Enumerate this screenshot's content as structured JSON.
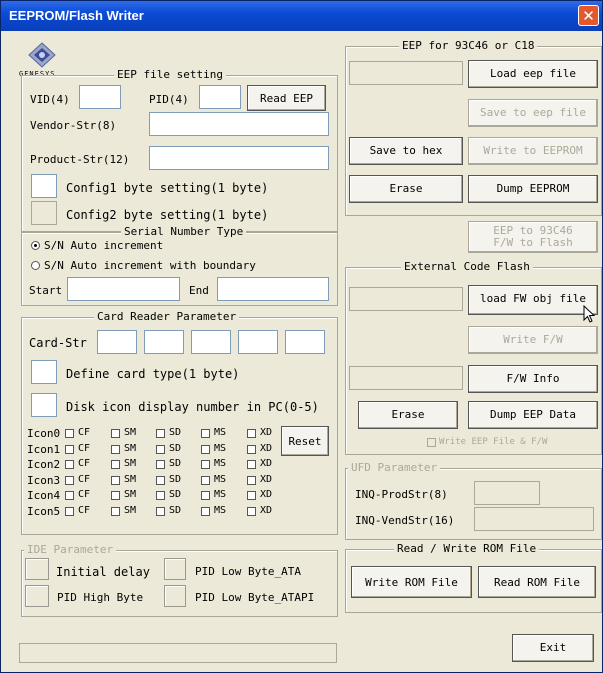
{
  "window": {
    "title": "EEPROM/Flash Writer",
    "close": "✕"
  },
  "logo": {
    "caption": "GENESYS"
  },
  "eep_file": {
    "legend": "EEP file setting",
    "vid_label": "VID(4)",
    "pid_label": "PID(4)",
    "read_eep": "Read EEP",
    "vendor_label": "Vendor-Str(8)",
    "product_label": "Product-Str(12)",
    "config1": "Config1 byte setting(1 byte)",
    "config2": "Config2 byte setting(1 byte)"
  },
  "serial": {
    "legend": "Serial Number Type",
    "opt1": "S/N Auto increment",
    "opt2": "S/N Auto increment with boundary",
    "start": "Start",
    "end": "End"
  },
  "card_reader": {
    "legend": "Card Reader Parameter",
    "card_str": "Card-Str",
    "define_type": "Define card type(1 byte)",
    "disk_icon": "Disk icon display number in PC(0-5)",
    "reset": "Reset",
    "columns": [
      "CF",
      "SM",
      "SD",
      "MS",
      "XD"
    ],
    "icons": [
      {
        "label": "Icon0",
        "cols": [
          "CF",
          "SM",
          "SD",
          "MS",
          "XD"
        ]
      },
      {
        "label": "Icon1",
        "cols": [
          "CF",
          "SM",
          "SD",
          "MS",
          "XD"
        ]
      },
      {
        "label": "Icon2",
        "cols": [
          "CF",
          "SM",
          "SD",
          "MS",
          "XD"
        ]
      },
      {
        "label": "Icon3",
        "cols": [
          "CF",
          "SM",
          "SD",
          "MS",
          "XD"
        ]
      },
      {
        "label": "Icon4",
        "cols": [
          "CF",
          "SM",
          "SD",
          "MS",
          "XD"
        ]
      },
      {
        "label": "Icon5",
        "cols": [
          "CF",
          "SM",
          "SD",
          "MS",
          "XD"
        ]
      }
    ]
  },
  "ide": {
    "legend": "IDE Parameter",
    "initial_delay": "Initial delay",
    "pid_low_ata": "PID Low Byte_ATA",
    "pid_high": "PID High Byte",
    "pid_low_atapi": "PID Low Byte_ATAPI"
  },
  "eep93": {
    "legend": "EEP for 93C46 or C18",
    "load_eep": "Load eep file",
    "save_to_eep": "Save to eep file",
    "save_to_hex": "Save to hex",
    "write_to_eeprom": "Write to EEPROM",
    "erase": "Erase",
    "dump_eeprom": "Dump EEPROM"
  },
  "eep_to_93c46": {
    "line1": "EEP to 93C46",
    "line2": "F/W to Flash"
  },
  "ext_flash": {
    "legend": "External Code Flash",
    "load_fw": "load FW obj file",
    "write_fw": "Write F/W",
    "fw_info": "F/W Info",
    "erase": "Erase",
    "dump_eep_data": "Dump EEP Data",
    "write_eep_fw": "Write EEP File & F/W"
  },
  "ufd": {
    "legend": "UFD Parameter",
    "inq_prod": "INQ-ProdStr(8)",
    "inq_vend": "INQ-VendStr(16)"
  },
  "rom": {
    "legend": "Read / Write ROM File",
    "write_rom": "Write ROM File",
    "read_rom": "Read ROM File"
  },
  "exit": "Exit"
}
